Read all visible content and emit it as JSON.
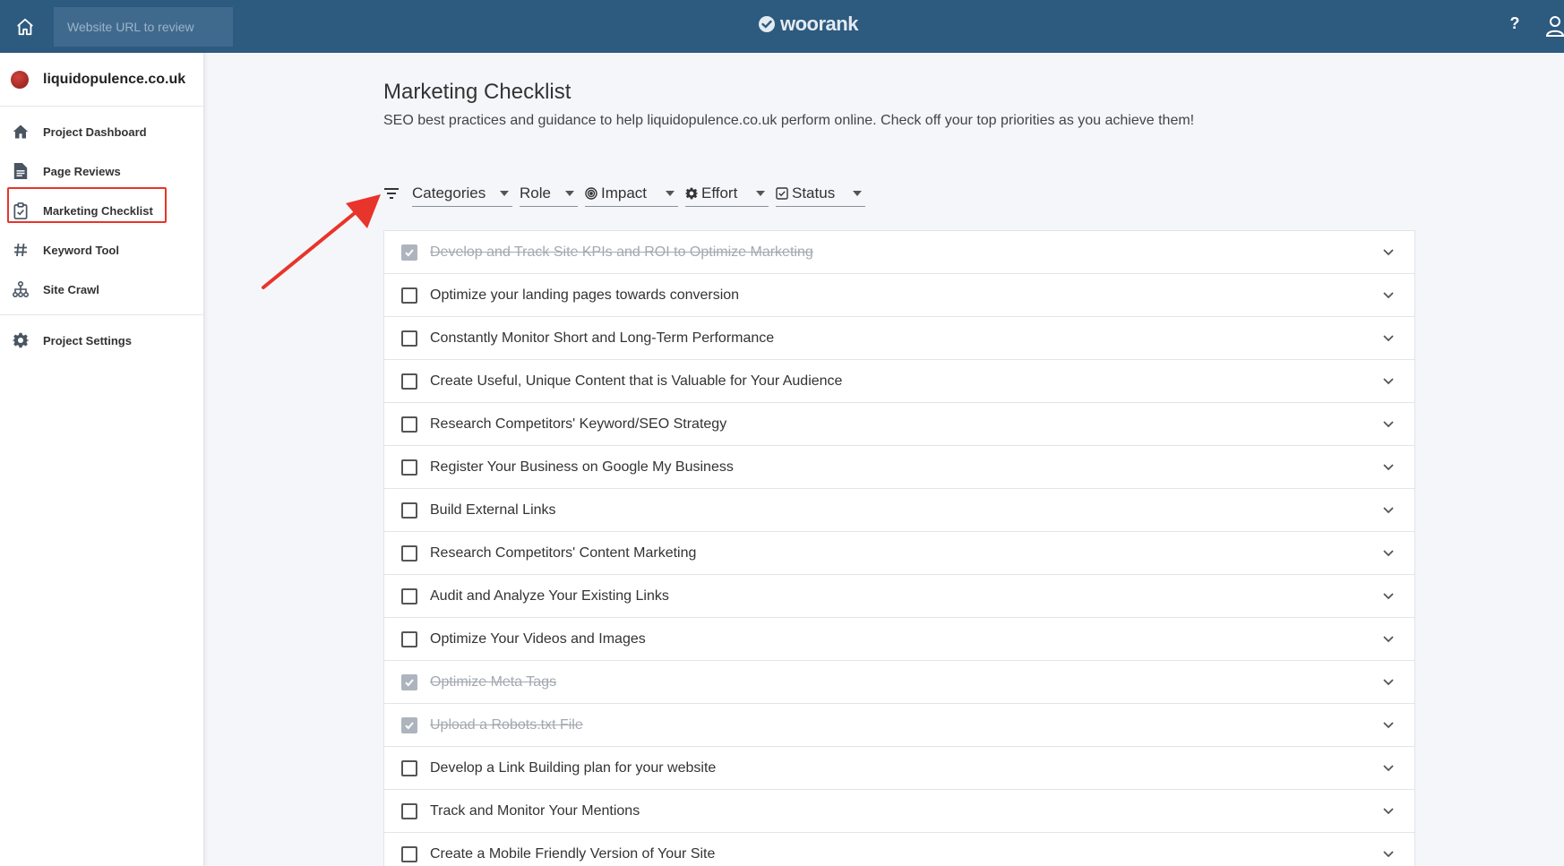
{
  "topbar": {
    "url_placeholder": "Website URL to review",
    "logo_text": "woorank",
    "help_label": "?"
  },
  "sidebar": {
    "project_name": "liquidopulence.co.uk",
    "items": [
      {
        "label": "Project Dashboard",
        "icon": "home-icon"
      },
      {
        "label": "Page Reviews",
        "icon": "document-icon"
      },
      {
        "label": "Marketing Checklist",
        "icon": "clipboard-check-icon"
      },
      {
        "label": "Keyword Tool",
        "icon": "hash-icon"
      },
      {
        "label": "Site Crawl",
        "icon": "sitemap-icon"
      }
    ],
    "settings_label": "Project Settings"
  },
  "main": {
    "title": "Marketing Checklist",
    "subtitle": "SEO best practices and guidance to help liquidopulence.co.uk perform online. Check off your top priorities as you achieve them!",
    "filters": [
      {
        "label": "Categories",
        "icon": ""
      },
      {
        "label": "Role",
        "icon": ""
      },
      {
        "label": "Impact",
        "icon": "target-icon"
      },
      {
        "label": "Effort",
        "icon": "gear-icon"
      },
      {
        "label": "Status",
        "icon": "checkbox-icon"
      }
    ],
    "checklist": [
      {
        "label": "Develop and Track Site KPIs and ROI to Optimize Marketing",
        "done": true
      },
      {
        "label": "Optimize your landing pages towards conversion",
        "done": false
      },
      {
        "label": "Constantly Monitor Short and Long-Term Performance",
        "done": false
      },
      {
        "label": "Create Useful, Unique Content that is Valuable for Your Audience",
        "done": false
      },
      {
        "label": "Research Competitors' Keyword/SEO Strategy",
        "done": false
      },
      {
        "label": "Register Your Business on Google My Business",
        "done": false
      },
      {
        "label": "Build External Links",
        "done": false
      },
      {
        "label": "Research Competitors' Content Marketing",
        "done": false
      },
      {
        "label": "Audit and Analyze Your Existing Links",
        "done": false
      },
      {
        "label": "Optimize Your Videos and Images",
        "done": false
      },
      {
        "label": "Optimize Meta Tags",
        "done": true
      },
      {
        "label": "Upload a Robots.txt File",
        "done": true
      },
      {
        "label": "Develop a Link Building plan for your website",
        "done": false
      },
      {
        "label": "Track and Monitor Your Mentions",
        "done": false
      },
      {
        "label": "Create a Mobile Friendly Version of Your Site",
        "done": false
      }
    ]
  },
  "colors": {
    "topbar": "#2d5a7f",
    "annotation": "#e8342a",
    "checked": "#aeb4bd"
  }
}
